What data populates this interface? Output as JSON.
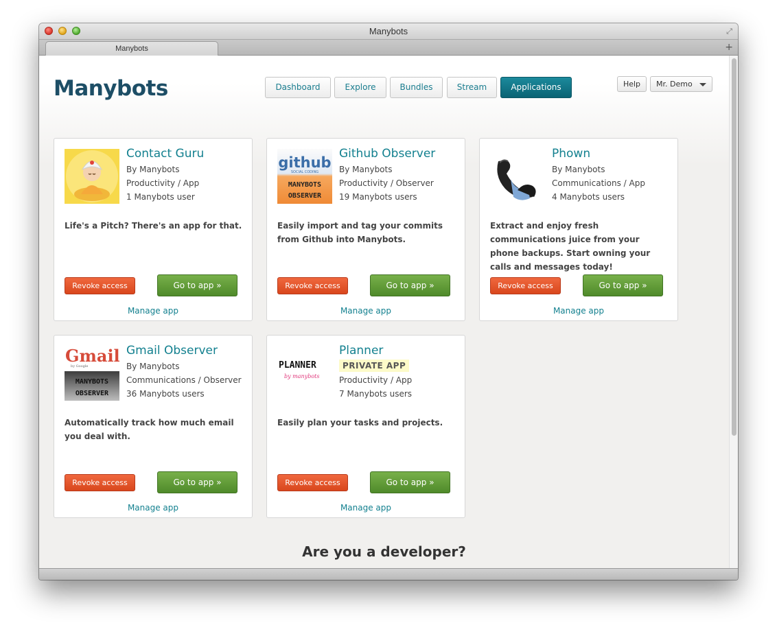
{
  "window": {
    "title": "Manybots",
    "tab_title": "Manybots"
  },
  "header": {
    "brand": "Manybots",
    "nav": [
      "Dashboard",
      "Explore",
      "Bundles",
      "Stream",
      "Applications"
    ],
    "active_nav": "Applications",
    "help_label": "Help",
    "user_label": "Mr. Demo"
  },
  "colors": {
    "accent": "#13808f",
    "brand": "#1d4e66",
    "revoke": "#e2532a",
    "go": "#5e9a36",
    "active_nav": "#0f7282"
  },
  "apps": [
    {
      "name": "Contact Guru",
      "by": "By Manybots",
      "category": "Productivity / App",
      "users": "1 Manybots user",
      "description": "Life's a Pitch? There's an app for that.",
      "revoke_label": "Revoke access",
      "goto_label": "Go to app »",
      "manage_label": "Manage app",
      "icon": "guru-icon"
    },
    {
      "name": "Github Observer",
      "by": "By Manybots",
      "category": "Productivity / Observer",
      "users": "19 Manybots users",
      "description": "Easily import and tag your commits from Github into Manybots.",
      "revoke_label": "Revoke access",
      "goto_label": "Go to app »",
      "manage_label": "Manage app",
      "icon": "github-icon",
      "icon_text": [
        "github",
        "SOCIAL CODING",
        "MANYBOTS",
        "OBSERVER"
      ]
    },
    {
      "name": "Phown",
      "by": "By Manybots",
      "category": "Communications / App",
      "users": "4 Manybots users",
      "description": "Extract and enjoy fresh communications juice from your phone backups. Start owning your calls and messages today!",
      "revoke_label": "Revoke access",
      "goto_label": "Go to app »",
      "manage_label": "Manage app",
      "icon": "phone-icon"
    },
    {
      "name": "Gmail Observer",
      "by": "By Manybots",
      "category": "Communications / Observer",
      "users": "36 Manybots users",
      "description": "Automatically track how much email you deal with.",
      "revoke_label": "Revoke access",
      "goto_label": "Go to app »",
      "manage_label": "Manage app",
      "icon": "gmail-icon",
      "icon_text": [
        "Gmail",
        "by Google",
        "MANYBOTS",
        "OBSERVER"
      ]
    },
    {
      "name": "Planner",
      "badge": "PRIVATE APP",
      "category": "Productivity / App",
      "users": "7 Manybots users",
      "description": "Easily plan your tasks and projects.",
      "revoke_label": "Revoke access",
      "goto_label": "Go to app »",
      "manage_label": "Manage app",
      "icon": "planner-icon",
      "icon_text": [
        "PLANNER",
        "by manybots"
      ]
    }
  ],
  "developer": {
    "heading": "Are you a developer?"
  }
}
